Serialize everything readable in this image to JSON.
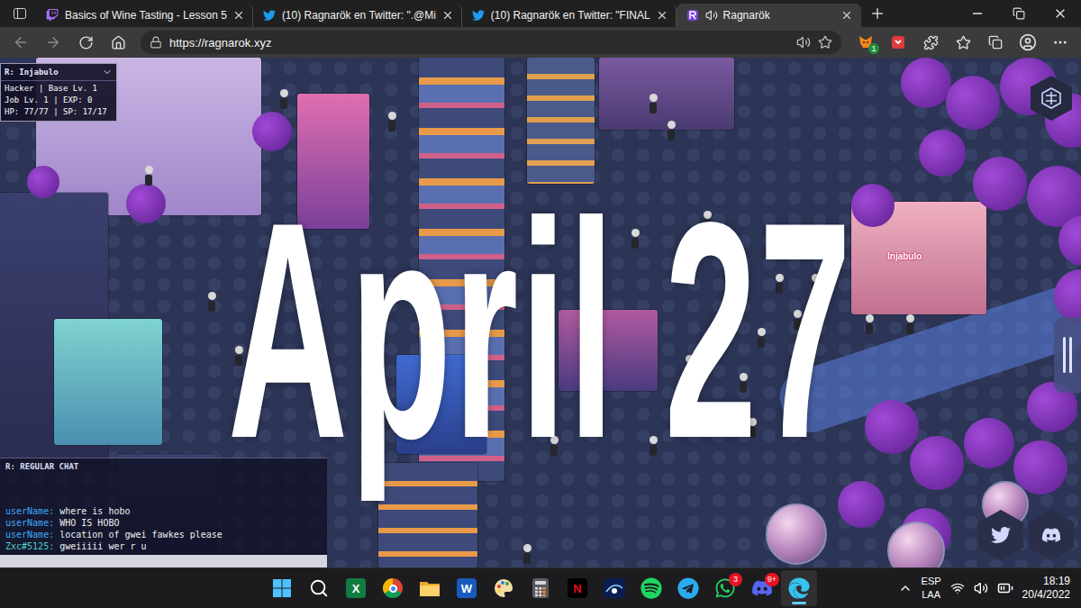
{
  "browser": {
    "tabs": [
      {
        "label": "Basics of Wine Tasting - Lesson 5",
        "selected": false,
        "kind": "twitch",
        "audio": false
      },
      {
        "label": "(10) Ragnarök en Twitter: \".@Mi",
        "selected": false,
        "kind": "twitter",
        "audio": false
      },
      {
        "label": "(10) Ragnarök en Twitter: \"FINAL",
        "selected": false,
        "kind": "twitter",
        "audio": false
      },
      {
        "label": "Ragnarök",
        "selected": true,
        "kind": "game",
        "audio": true
      }
    ],
    "address": "https://ragnarok.xyz",
    "extension_badge": "1"
  },
  "game": {
    "player": {
      "prefix": "R:",
      "name": "Injabulo",
      "lines": [
        "Hacker | Base Lv. 1",
        "Job Lv. 1 | EXP: 0",
        "HP: 77/77 | SP: 17/17"
      ]
    },
    "announcement": "April 27",
    "house_label": "Injabulo",
    "chat": {
      "prefix": "R:",
      "title": "REGULAR CHAT",
      "messages": [
        {
          "user": "userName:",
          "text": "where is hobo",
          "color": "#3fa9f5"
        },
        {
          "user": "userName:",
          "text": "WHO IS HOBO",
          "color": "#3fa9f5"
        },
        {
          "user": "userName:",
          "text": "location of gwei fawkes please",
          "color": "#3fa9f5"
        },
        {
          "user": "Zxc#5125:",
          "text": "gweiiiii wer r u",
          "color": "#4fd1c5"
        }
      ]
    }
  },
  "taskbar": {
    "apps": [
      {
        "kind": "windows",
        "selected": false
      },
      {
        "kind": "search",
        "selected": false
      },
      {
        "kind": "excel",
        "glyph": "X",
        "selected": false
      },
      {
        "kind": "chrome",
        "selected": false
      },
      {
        "kind": "explorer",
        "selected": false
      },
      {
        "kind": "word",
        "glyph": "W",
        "selected": false
      },
      {
        "kind": "paint",
        "selected": false
      },
      {
        "kind": "calculator",
        "selected": false
      },
      {
        "kind": "netflix",
        "glyph": "N",
        "selected": false
      },
      {
        "kind": "disney",
        "selected": false
      },
      {
        "kind": "spotify",
        "selected": false
      },
      {
        "kind": "telegram",
        "selected": false
      },
      {
        "kind": "whatsapp",
        "badge": "3",
        "selected": false
      },
      {
        "kind": "discord",
        "badge": "9+",
        "selected": false
      },
      {
        "kind": "edge",
        "selected": true
      }
    ],
    "tray": {
      "language": "ESP",
      "layout": "LAA",
      "time": "18:19",
      "date": "20/4/2022"
    }
  }
}
